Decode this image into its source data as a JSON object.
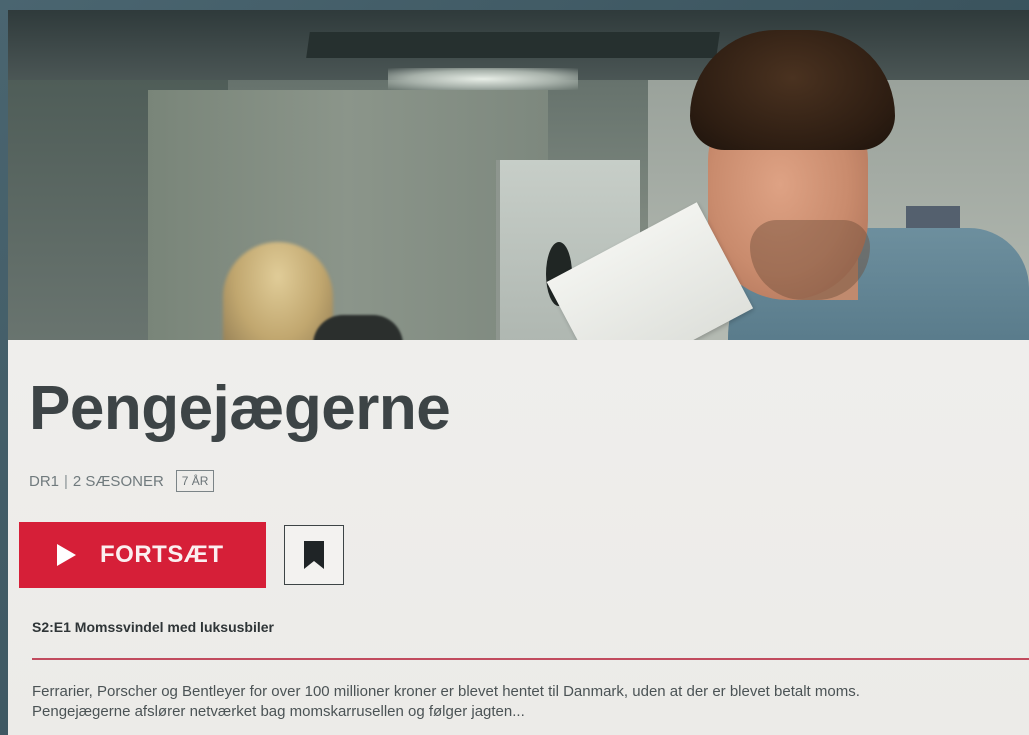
{
  "show": {
    "title": "Pengejægerne",
    "channel": "DR1",
    "meta_separator": "|",
    "seasons": "2 SÆSONER",
    "age_rating": "7 ÅR"
  },
  "actions": {
    "continue_label": "FORTSÆT",
    "play_icon": "play-icon",
    "bookmark_icon": "bookmark-icon"
  },
  "episode": {
    "label": "S2:E1 Momssvindel med luksusbiler",
    "description": "Ferrarier, Porscher og Bentleyer for over 100 millioner kroner er blevet hentet til Danmark, uden at der er blevet betalt moms. Pengejægerne afslører netværket bag momskarrusellen og følger jagten..."
  },
  "colors": {
    "accent": "#d61f38",
    "title_text": "#3d4446",
    "panel_bg": "#efeeec",
    "divider": "#c14b5e"
  }
}
